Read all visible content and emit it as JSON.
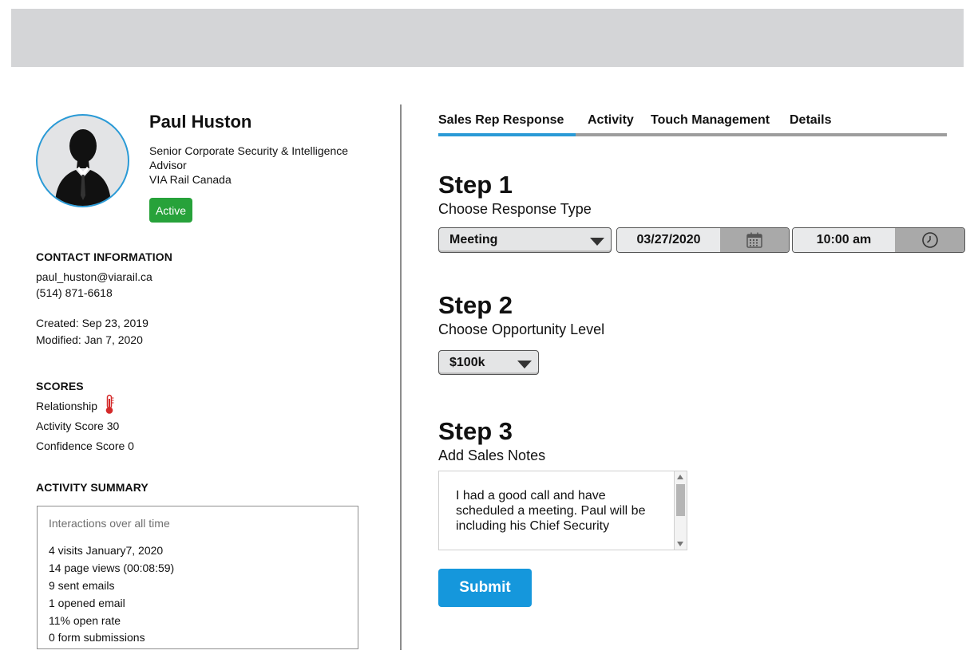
{
  "profile": {
    "name": "Paul Huston",
    "title": "Senior Corporate Security & Intelligence Advisor",
    "company": "VIA Rail Canada",
    "status": "Active",
    "status_color": "#27a23a"
  },
  "contact": {
    "heading": "CONTACT INFORMATION",
    "email": "paul_huston@viarail.ca",
    "phone": "(514) 871-6618",
    "created": "Created: Sep 23, 2019",
    "modified": "Modified: Jan 7, 2020"
  },
  "scores": {
    "heading": "SCORES",
    "relationship": "Relationship",
    "relationship_icon": "thermometer-icon",
    "activity": "Activity Score 30",
    "confidence": "Confidence Score 0"
  },
  "activity_summary": {
    "heading": "ACTIVITY SUMMARY",
    "subheading": "Interactions over all time",
    "lines": [
      "4 visits January7, 2020",
      "14 page views (00:08:59)",
      "9 sent emails",
      "1 opened email",
      "11% open rate",
      "0 form submissions"
    ]
  },
  "tabs": [
    {
      "label": "Sales Rep Response",
      "active": true
    },
    {
      "label": "Activity",
      "active": false
    },
    {
      "label": "Touch Management",
      "active": false
    },
    {
      "label": "Details",
      "active": false
    }
  ],
  "step1": {
    "title": "Step 1",
    "subtitle": "Choose Response Type",
    "response_type": "Meeting",
    "date": "03/27/2020",
    "date_icon": "calendar-icon",
    "time": "10:00 am",
    "time_icon": "clock-icon"
  },
  "step2": {
    "title": "Step 2",
    "subtitle": "Choose Opportunity Level",
    "level": "$100k"
  },
  "step3": {
    "title": "Step 3",
    "subtitle": "Add Sales Notes",
    "notes": "I had a good call and have scheduled a meeting. Paul will be including his Chief Security"
  },
  "submit_label": "Submit",
  "colors": {
    "accent": "#1597dc",
    "tab_active": "#2a9ad6",
    "header_bar": "#d4d5d7"
  }
}
